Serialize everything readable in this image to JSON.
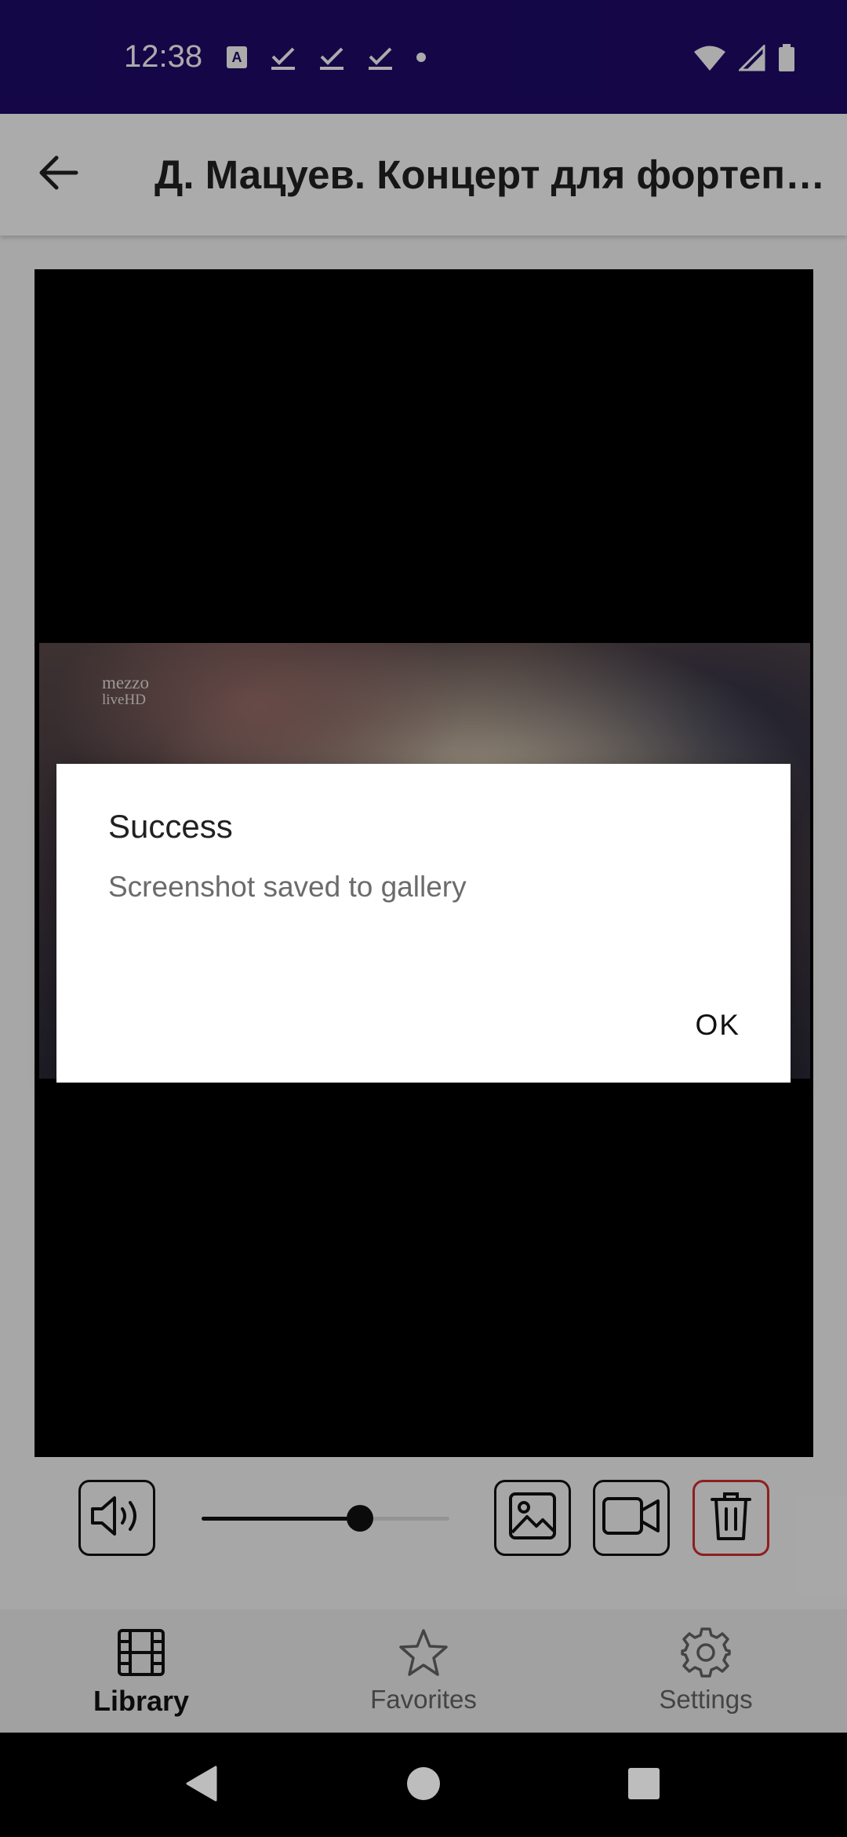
{
  "status_bar": {
    "time": "12:38",
    "left_icons": [
      "font-a-icon",
      "check-icon",
      "check-icon",
      "check-icon",
      "dot-icon"
    ],
    "right_icons": [
      "wifi-icon",
      "signal-icon",
      "battery-icon"
    ]
  },
  "app_bar": {
    "back_icon": "arrow-left-icon",
    "title": "Д. Мацуев. Концерт для фортепиано с оркестром"
  },
  "video": {
    "overlay_logo_line1": "mezzo",
    "overlay_logo_line2": "liveHD"
  },
  "controls": {
    "volume_icon": "speaker-icon",
    "volume_level": 0.64,
    "screenshot_icon": "image-icon",
    "record_icon": "video-camera-icon",
    "delete_icon": "trash-icon",
    "delete_color": "#d32f2f"
  },
  "bottom_nav": {
    "items": [
      {
        "label": "Library",
        "icon": "film-icon",
        "active": true
      },
      {
        "label": "Favorites",
        "icon": "star-icon",
        "active": false
      },
      {
        "label": "Settings",
        "icon": "gear-icon",
        "active": false
      }
    ]
  },
  "system_nav": {
    "icons": [
      "back-triangle-icon",
      "home-circle-icon",
      "recents-square-icon"
    ]
  },
  "dialog": {
    "title": "Success",
    "message": "Screenshot saved to gallery",
    "ok_label": "OK"
  },
  "colors": {
    "status_bar": "#1e0a6b",
    "scrim": "rgba(0,0,0,0.33)"
  }
}
